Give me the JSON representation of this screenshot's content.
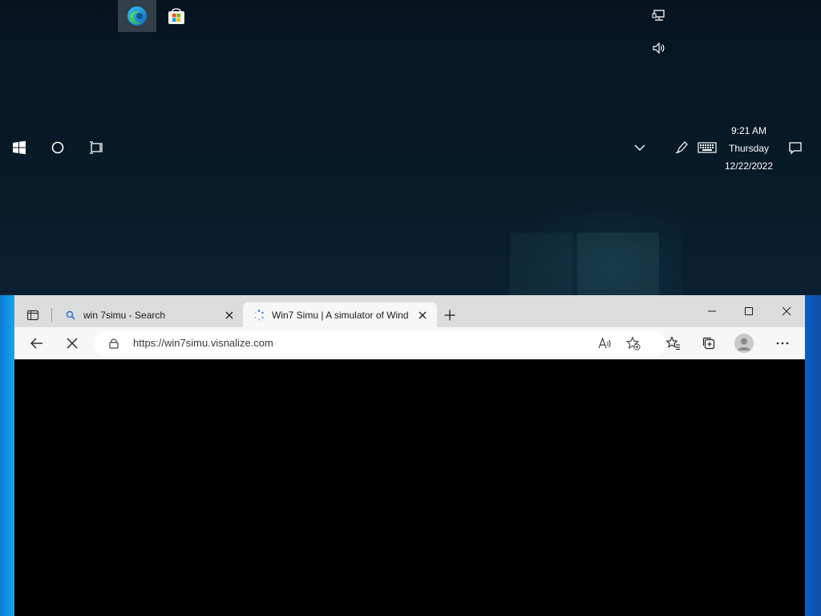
{
  "colors": {
    "desktop_bg": "#071a27",
    "taskbar_icon": "#ffffff",
    "tabstrip_bg": "#dcdcdc",
    "toolbar_bg": "#f7f7f7",
    "content_bg": "#000000",
    "side_strip": "#1aa4f0"
  },
  "taskbar": {
    "pinned": [
      {
        "name": "Microsoft Edge",
        "icon": "edge-icon",
        "active": true
      },
      {
        "name": "Microsoft Store",
        "icon": "store-icon",
        "active": false
      }
    ],
    "start_icon": "windows-logo-icon",
    "search_icon": "cortana-circle-icon",
    "task_view_icon": "task-view-icon",
    "tray": {
      "network_icon": "network-icon",
      "volume_icon": "volume-icon",
      "overflow_icon": "chevron-up-icon",
      "pen_icon": "pen-icon",
      "keyboard_icon": "touch-keyboard-icon",
      "notifications_icon": "action-center-icon"
    },
    "clock": {
      "time": "9:21 AM",
      "day": "Thursday",
      "date": "12/22/2022"
    }
  },
  "browser": {
    "tabs": [
      {
        "title": "win 7simu - Search",
        "icon": "search-icon",
        "active": false
      },
      {
        "title": "Win7 Simu | A simulator of Wind",
        "icon": "loading-spinner-icon",
        "active": true
      }
    ],
    "address": {
      "url": "https://win7simu.visnalize.com",
      "secure_icon": "lock-icon"
    },
    "toolbar_icons": {
      "back": "back-arrow-icon",
      "stop": "stop-x-icon",
      "read_aloud": "read-aloud-icon",
      "add_favorite": "add-favorite-icon",
      "favorites": "favorites-icon",
      "collections": "collections-icon",
      "profile": "profile-avatar-icon",
      "more": "more-dots-icon"
    },
    "window_controls": [
      "minimize-icon",
      "maximize-icon",
      "close-icon"
    ]
  }
}
